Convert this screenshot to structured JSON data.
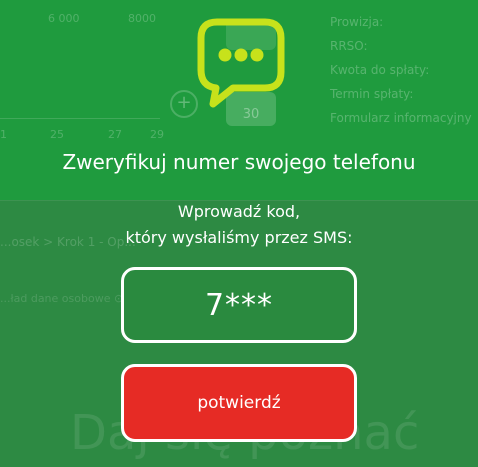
{
  "background": {
    "tick_labels_top": [
      "6 000",
      "8000"
    ],
    "tick_labels_bottom": [
      "1",
      "25",
      "27",
      "29"
    ],
    "info_labels": [
      "Prowizja:",
      "RRSO:",
      "Kwota do spłaty:",
      "Termin spłaty:",
      "Formularz informacyjny"
    ],
    "box_value": "30",
    "plus": "+",
    "breadcrumb": "...osek > Krok 1 - Op...",
    "steps": "...ład dane osobowe  ⊙ Krok 2  ...ane  osobowe      ⊙ Krok 3",
    "heading": "Daj się poznać"
  },
  "modal": {
    "title": "Zweryfikuj numer swojego telefonu",
    "subtitle_line1": "Wprowadź kod,",
    "subtitle_line2": "który wysłaliśmy przez SMS:",
    "code_value": "7***",
    "confirm_label": "potwierdź"
  },
  "colors": {
    "page_green": "#1f9b3e",
    "icon_lime": "#c7e21b",
    "confirm_red": "#e62b25"
  },
  "icons": {
    "chat": "chat-bubble-icon"
  }
}
